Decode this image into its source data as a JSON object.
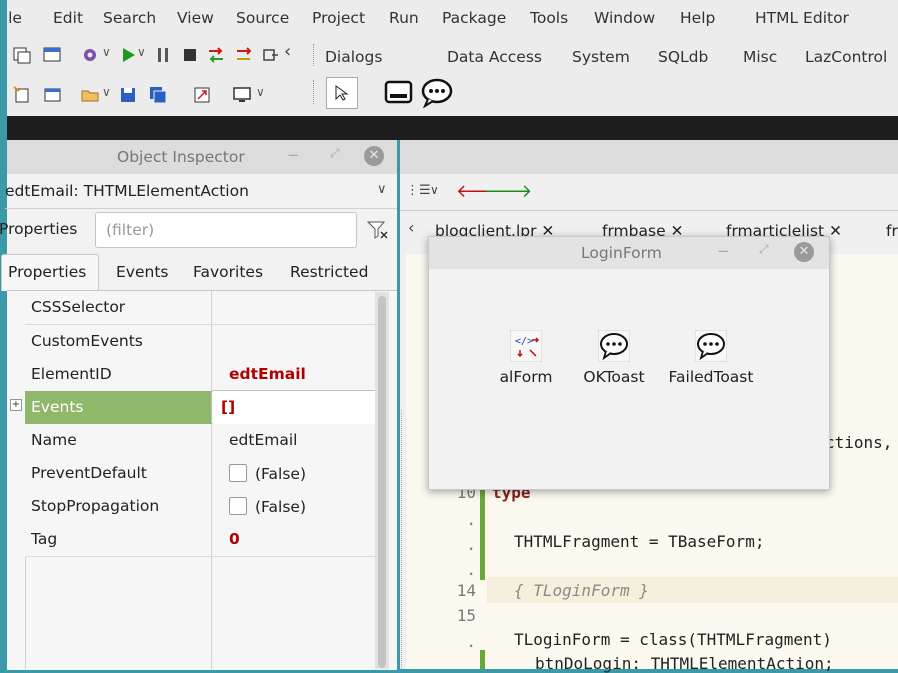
{
  "menu": [
    "File",
    "Edit",
    "Search",
    "View",
    "Source",
    "Project",
    "Run",
    "Package",
    "Tools",
    "Window",
    "Help",
    "HTML Editor"
  ],
  "palette_tabs": [
    "Dialogs",
    "Data Access",
    "System",
    "SQLdb",
    "Misc",
    "LazControl"
  ],
  "inspector": {
    "title": "Object Inspector",
    "component_selector": "edtEmail: THTMLElementAction",
    "properties_label": "Properties",
    "filter_placeholder": "(filter)",
    "tabs": [
      "Properties",
      "Events",
      "Favorites",
      "Restricted"
    ],
    "rows": [
      {
        "name": "CSSSelector",
        "value": ""
      },
      {
        "name": "CustomEvents",
        "value": ""
      },
      {
        "name": "ElementID",
        "value": "edtEmail"
      },
      {
        "name": "Events",
        "value": "[]"
      },
      {
        "name": "Name",
        "value": "edtEmail"
      },
      {
        "name": "PreventDefault",
        "value": "(False)"
      },
      {
        "name": "StopPropagation",
        "value": "(False)"
      },
      {
        "name": "Tag",
        "value": "0"
      }
    ]
  },
  "editor": {
    "tabs": [
      "blogclient.lpr",
      "frmbase",
      "frmarticlelist",
      "fr"
    ],
    "lines": [
      {
        "num": "",
        "text": "ctions,"
      },
      {
        "num": "10",
        "text": "type"
      },
      {
        "num": ".",
        "text": ""
      },
      {
        "num": ".",
        "text": "THTMLFragment = TBaseForm;"
      },
      {
        "num": ".",
        "text": ""
      },
      {
        "num": "14",
        "text": "{ TLoginForm }"
      },
      {
        "num": "15",
        "text": ""
      },
      {
        "num": ".",
        "text": "TLoginForm = class(THTMLFragment)"
      },
      {
        "num": ".",
        "text": "btnDoLogin: THTMLElementAction;"
      }
    ]
  },
  "loginform": {
    "title": "LoginForm",
    "components": [
      {
        "label": "alForm",
        "icon": "action-list-icon"
      },
      {
        "label": "OKToast",
        "icon": "speech-bubble-icon"
      },
      {
        "label": "FailedToast",
        "icon": "speech-bubble-icon"
      }
    ]
  },
  "colors": {
    "accent_red": "#b00000",
    "selected_row": "#8fb86a",
    "teal_bg": "#3a9aa8"
  }
}
